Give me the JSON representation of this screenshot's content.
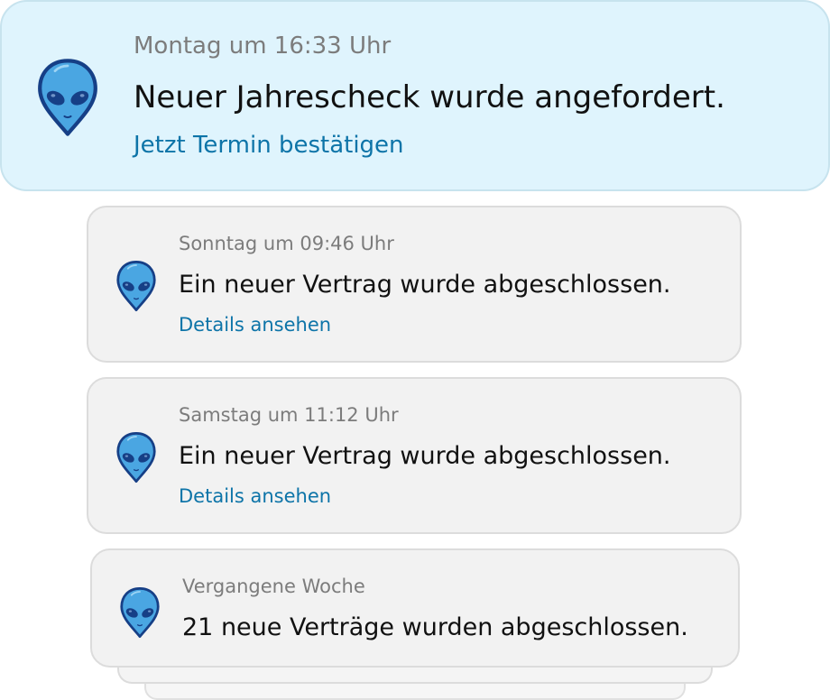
{
  "notifications": [
    {
      "time": "Montag um 16:33 Uhr",
      "message": "Neuer Jahrescheck wurde angefordert.",
      "action": "Jetzt Termin bestätigen",
      "icon": "alien-icon"
    },
    {
      "time": "Sonntag um 09:46 Uhr",
      "message": "Ein neuer Vertrag wurde abgeschlossen.",
      "action": "Details ansehen",
      "icon": "alien-icon"
    },
    {
      "time": "Samstag um 11:12 Uhr",
      "message": "Ein neuer Vertrag wurde abgeschlossen.",
      "action": "Details ansehen",
      "icon": "alien-icon"
    },
    {
      "time": "Vergangene Woche",
      "message": "21 neue Verträge wurden abgeschlossen.",
      "icon": "alien-icon"
    }
  ],
  "colors": {
    "featured_background": "#dff4fd",
    "card_background": "#f2f2f2",
    "link": "#0d74a8",
    "alien_fill": "#4aa6e2",
    "alien_outline": "#163f86"
  }
}
